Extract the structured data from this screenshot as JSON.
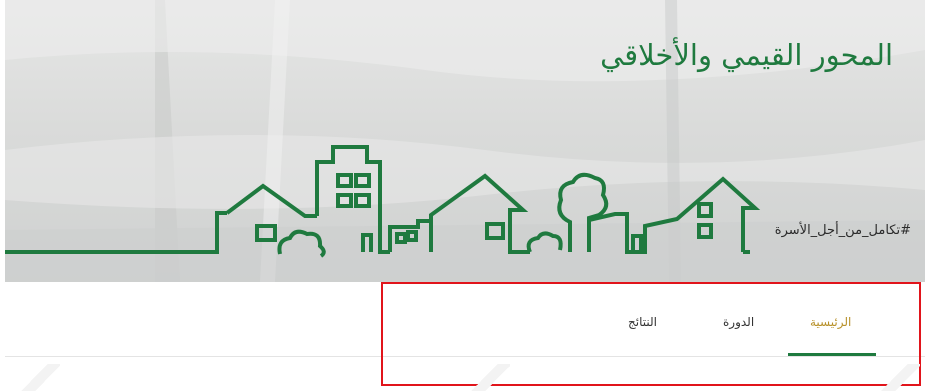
{
  "banner": {
    "title": "المحور القيمي والأخلاقي",
    "hashtag": "#تكامل_من_أجل_الأسرة",
    "accent_color": "#1f7a3f"
  },
  "nav": {
    "tabs": [
      {
        "label": "الرئيسية",
        "active": true
      },
      {
        "label": "الدورة",
        "active": false
      },
      {
        "label": "النتائج",
        "active": false
      }
    ],
    "active_color": "#b8912a",
    "indicator_color": "#1f7a3f",
    "highlight_color": "#e1141b"
  }
}
